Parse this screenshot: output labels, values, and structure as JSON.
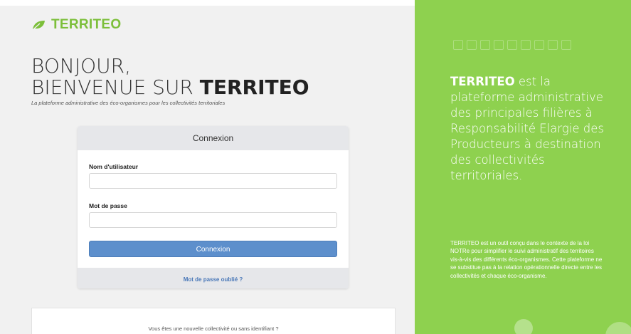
{
  "brand": {
    "name": "TERRITEO",
    "accent": "#7cbf3a",
    "panel_color": "#8ed14f"
  },
  "welcome": {
    "line1": "BONJOUR,",
    "line2_prefix": "BIENVENUE SUR ",
    "line2_brand": "TERRITEO",
    "tagline": "La plateforme administrative des éco-organismes pour les collectivités territoriales"
  },
  "login": {
    "title": "Connexion",
    "username_label": "Nom d'utilisateur",
    "username_value": "",
    "password_label": "Mot de passe",
    "password_value": "",
    "submit_label": "Connexion",
    "submit_color": "#5d8fcc",
    "forgot_label": "Mot de passe oublié ?"
  },
  "signup": {
    "prompt": "Vous êtes une nouvelle collectivité ou sans identifiant ?"
  },
  "panel": {
    "icon_names": [
      "lamp-icon",
      "furniture-icon",
      "bottle-icon",
      "battery-icon",
      "appliance-icon",
      "book-icon",
      "medicine-icon",
      "packaging-icon",
      "textile-icon"
    ],
    "headline_brand": "TERRITEO",
    "headline_rest": " est la plateforme administrative des principales filières à Responsabilité Elargie des Producteurs à destination des collectivités territoriales.",
    "description": "TERRITEO est un outil conçu dans le contexte de la loi NOTRe pour simplifier le suivi administratif des territoires vis-à-vis des différents éco-organismes. Cette plateforme ne se substitue pas à la relation opérationnelle directe entre les collectivités et chaque éco-organisme."
  }
}
